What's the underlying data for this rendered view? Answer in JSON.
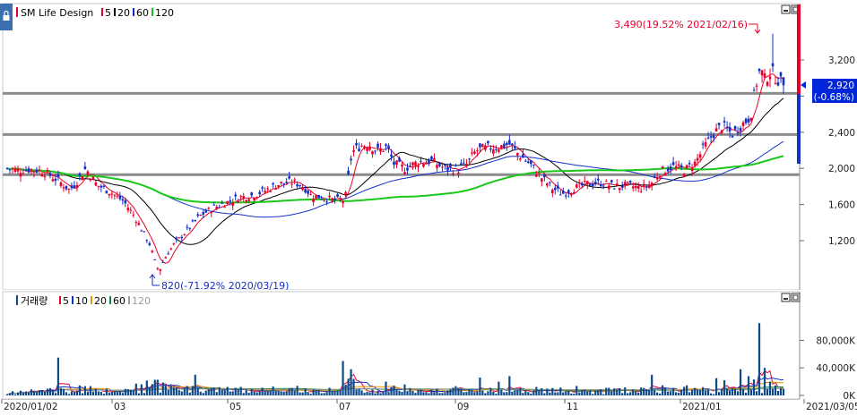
{
  "colors": {
    "up": "#e8002a",
    "down": "#1430c8",
    "ma5": "#e8002a",
    "ma20": "#000000",
    "ma60": "#1430c8",
    "ma120": "#19c819",
    "support_line": "#8c8c8c",
    "current_price_bg": "#0026d9",
    "volume_bar": "#0e4a8a"
  },
  "price_pane": {
    "side_tab_icon": "lock-icon",
    "stock_name": "SM Life Design",
    "ma_legend": [
      {
        "label": "5",
        "color": "#e8002a"
      },
      {
        "label": "20",
        "color": "#000000"
      },
      {
        "label": "60",
        "color": "#1430c8"
      },
      {
        "label": "120",
        "color": "#19c819"
      }
    ],
    "y_ticks": [
      "3,200",
      "2,800",
      "2,400",
      "2,000",
      "1,600",
      "1,200"
    ],
    "high_annotation": "3,490(19.52% 2021/02/16)",
    "low_annotation": "820(-71.92% 2020/03/19)",
    "current_price": "2,920",
    "current_change": "(-0.68%)"
  },
  "volume_pane": {
    "title": "거래량",
    "ma_legend": [
      {
        "label": "5",
        "color": "#e8002a"
      },
      {
        "label": "10",
        "color": "#1430c8"
      },
      {
        "label": "20",
        "color": "#e89600"
      },
      {
        "label": "60",
        "color": "#0a8a3a"
      },
      {
        "label": "120",
        "color": "#9a9a9a"
      }
    ],
    "y_ticks": [
      "80,000K",
      "40,000K",
      "0K"
    ]
  },
  "x_axis": {
    "labels": [
      "2020/01/02",
      "03",
      "05",
      "07",
      "09",
      "11",
      "2021/01",
      "2021/03/05"
    ]
  },
  "chart_data": {
    "type": "candlestick",
    "ylim": [
      820,
      3490
    ],
    "support_lines": [
      2830,
      2375,
      1930
    ],
    "series_description": "daily price with 5/20/60/120-day moving averages",
    "key_points": [
      {
        "date": "2020/01/02",
        "close": 2000
      },
      {
        "date": "2020/03/19",
        "low": 820
      },
      {
        "date": "2020/07",
        "close": 2250
      },
      {
        "date": "2020/09",
        "close": 2100
      },
      {
        "date": "2020/11",
        "close": 1800
      },
      {
        "date": "2021/02/16",
        "high": 3490
      },
      {
        "date": "2021/03/05",
        "close": 2920
      }
    ],
    "volume_ylim": [
      0,
      100000
    ]
  }
}
